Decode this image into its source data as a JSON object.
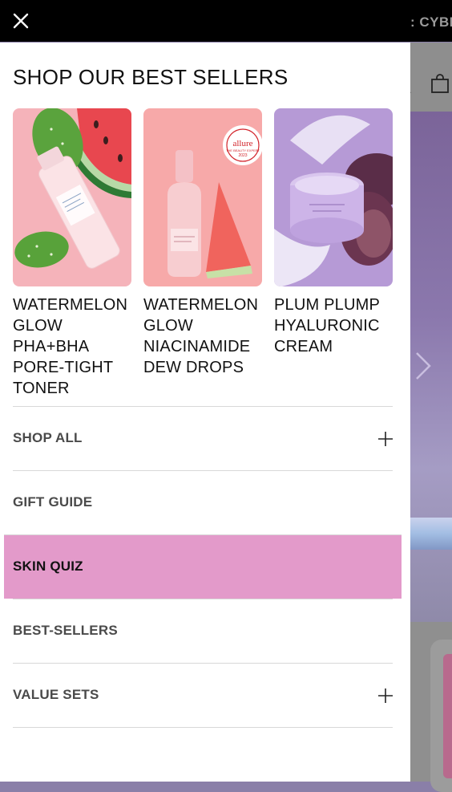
{
  "background": {
    "promo_text": ": CYBE",
    "icons": [
      "bag-icon",
      "chevron-right-icon"
    ]
  },
  "drawer": {
    "close_icon": "close-icon",
    "title": "SHOP OUR BEST SELLERS",
    "products": [
      {
        "name": "WATERMELON GLOW PHA+BHA PORE-TIGHT TONER"
      },
      {
        "name": "WATERMELON GLOW NIACINAMIDE DEW DROPS",
        "badge": {
          "title": "allure",
          "subtitle": "THE BEAUTY EXPERT",
          "year": "2023"
        }
      },
      {
        "name": "PLUM PLUMP HYALURONIC CREAM"
      }
    ],
    "nav": [
      {
        "label": "SHOP ALL",
        "expandable": true
      },
      {
        "label": "GIFT GUIDE",
        "expandable": false
      },
      {
        "label": "SKIN QUIZ",
        "expandable": false,
        "highlighted": true
      },
      {
        "label": "BEST-SELLERS",
        "expandable": false
      },
      {
        "label": "VALUE SETS",
        "expandable": true
      }
    ]
  },
  "colors": {
    "highlight": "#e39aca",
    "topbar": "#000000",
    "text": "#111111",
    "nav_text": "#4a4a4a"
  }
}
